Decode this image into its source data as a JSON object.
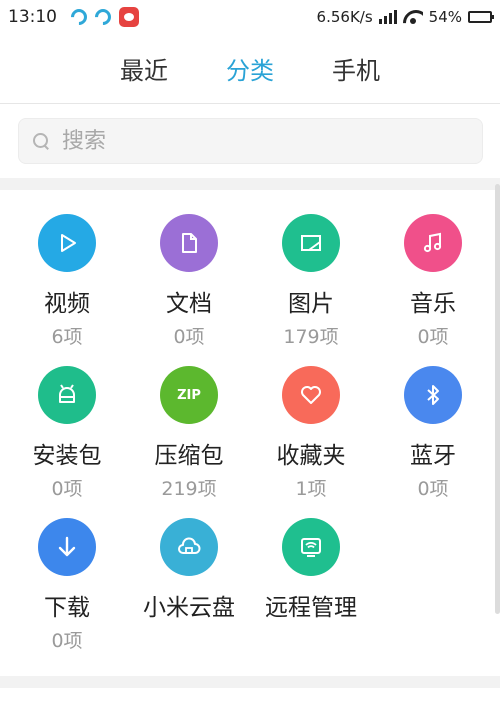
{
  "status_bar": {
    "time": "13:10",
    "speed": "6.56K/s",
    "battery": "54%",
    "battery_level": 0.54
  },
  "tabs": [
    {
      "label": "最近"
    },
    {
      "label": "分类",
      "active": true
    },
    {
      "label": "手机"
    }
  ],
  "search": {
    "placeholder": "搜索"
  },
  "categories": [
    {
      "name": "视频",
      "count": "6项",
      "color": "#25a9e5",
      "icon": "play-icon"
    },
    {
      "name": "文档",
      "count": "0项",
      "color": "#9b6fd6",
      "icon": "document-icon"
    },
    {
      "name": "图片",
      "count": "179项",
      "color": "#1fbf8f",
      "icon": "image-icon"
    },
    {
      "name": "音乐",
      "count": "0项",
      "color": "#f0508a",
      "icon": "music-icon"
    },
    {
      "name": "安装包",
      "count": "0项",
      "color": "#1fbd8b",
      "icon": "android-icon"
    },
    {
      "name": "压缩包",
      "count": "219项",
      "color": "#5cb82e",
      "icon": "zip-icon",
      "icon_text": "ZIP"
    },
    {
      "name": "收藏夹",
      "count": "1项",
      "color": "#f86a5a",
      "icon": "heart-icon"
    },
    {
      "name": "蓝牙",
      "count": "0项",
      "color": "#4a88ee",
      "icon": "bluetooth-icon"
    },
    {
      "name": "下载",
      "count": "0项",
      "color": "#3d87ec",
      "icon": "download-icon"
    },
    {
      "name": "小米云盘",
      "count": "",
      "color": "#39b0d6",
      "icon": "cloud-drive-icon"
    },
    {
      "name": "远程管理",
      "count": "",
      "color": "#1fbf8f",
      "icon": "remote-icon"
    }
  ]
}
